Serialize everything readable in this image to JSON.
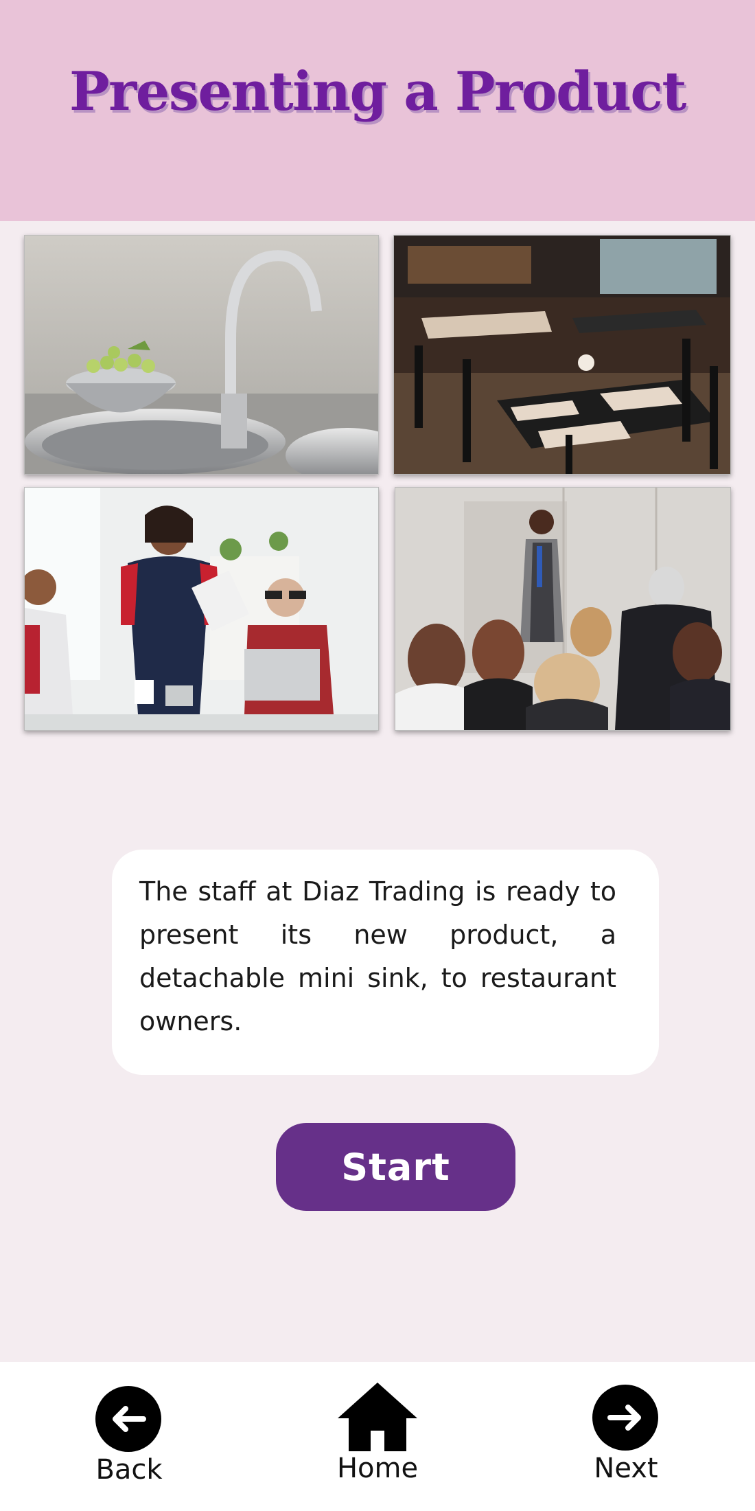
{
  "header": {
    "title": "Presenting a Product",
    "background": "#e9c3d8",
    "title_color": "#6f1e9e"
  },
  "gallery": [
    {
      "name": "kitchen-sink-photo"
    },
    {
      "name": "restaurant-interior-photo"
    },
    {
      "name": "office-meeting-photo"
    },
    {
      "name": "audience-presentation-photo"
    }
  ],
  "description": {
    "text": "The staff at Diaz Trading is ready to present its new product, a detachable mini sink, to restaurant owners."
  },
  "start_button": {
    "label": "Start",
    "color": "#663089"
  },
  "footer": {
    "back_label": "Back",
    "home_label": "Home",
    "next_label": "Next",
    "icons": {
      "back": "arrow-left-icon",
      "home": "home-icon",
      "next": "arrow-right-icon"
    }
  }
}
